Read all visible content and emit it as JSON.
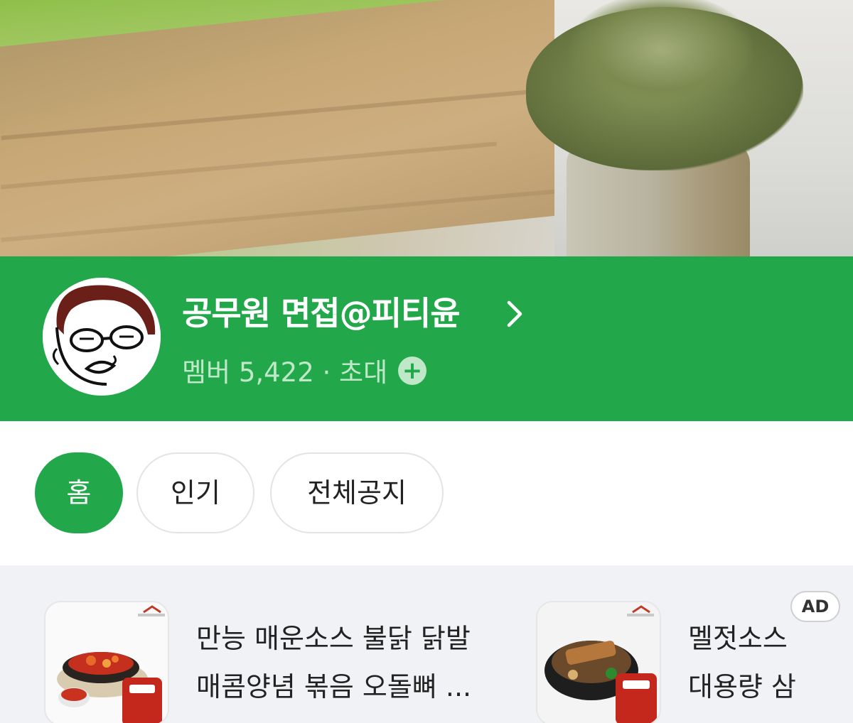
{
  "cafe": {
    "title": "공무원 면접@피티윤",
    "meta": "멤버 5,422 · 초대",
    "accent_color": "#22a84a"
  },
  "tabs": [
    {
      "label": "홈",
      "active": true
    },
    {
      "label": "인기",
      "active": false
    },
    {
      "label": "전체공지",
      "active": false
    }
  ],
  "ads": {
    "badge": "AD",
    "items": [
      {
        "line1": "만능 매운소스 불닭 닭발",
        "line2": "매콤양념 볶음 오돌뼈 ..."
      },
      {
        "line1": "멜젓소스 ",
        "line2": "대용량 삼"
      }
    ]
  },
  "icons": [
    "chevron-right-icon",
    "plus-circle-icon",
    "cafe-avatar"
  ]
}
